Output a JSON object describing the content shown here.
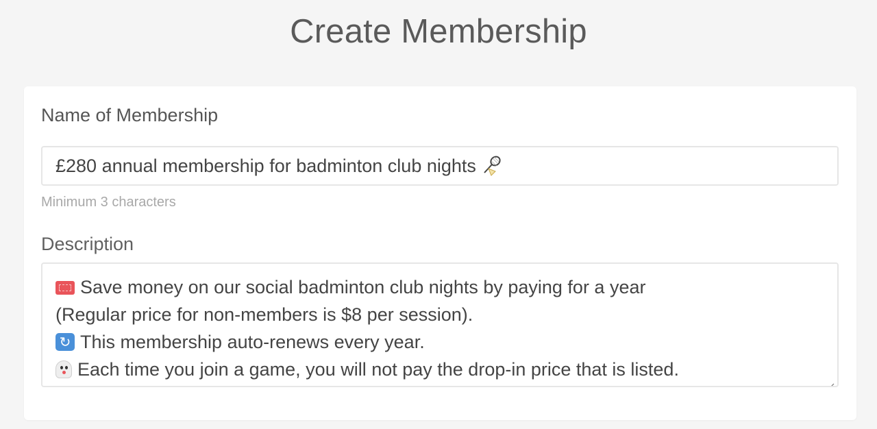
{
  "page": {
    "title": "Create Membership"
  },
  "form": {
    "name_label": "Name of Membership",
    "name_value": "£280 annual membership for badminton club nights",
    "name_emoji": "badminton-racket-icon",
    "name_hint": "Minimum 3 characters",
    "description_label": "Description",
    "description_lines": [
      {
        "emoji": "ticket-icon",
        "text": "Save money on our social badminton club nights by paying for a year"
      },
      {
        "emoji": "",
        "text": "(Regular price for non-members is $8 per session)."
      },
      {
        "emoji": "repeat-icon",
        "text": "This membership auto-renews every year."
      },
      {
        "emoji": "ghost-icon",
        "text": "Each time you join a game, you will not pay the drop-in price that is listed."
      }
    ]
  },
  "colors": {
    "background": "#f5f5f5",
    "card": "#ffffff",
    "text": "#555555",
    "hint": "#a8a8a8",
    "border": "#e6e6e6"
  }
}
